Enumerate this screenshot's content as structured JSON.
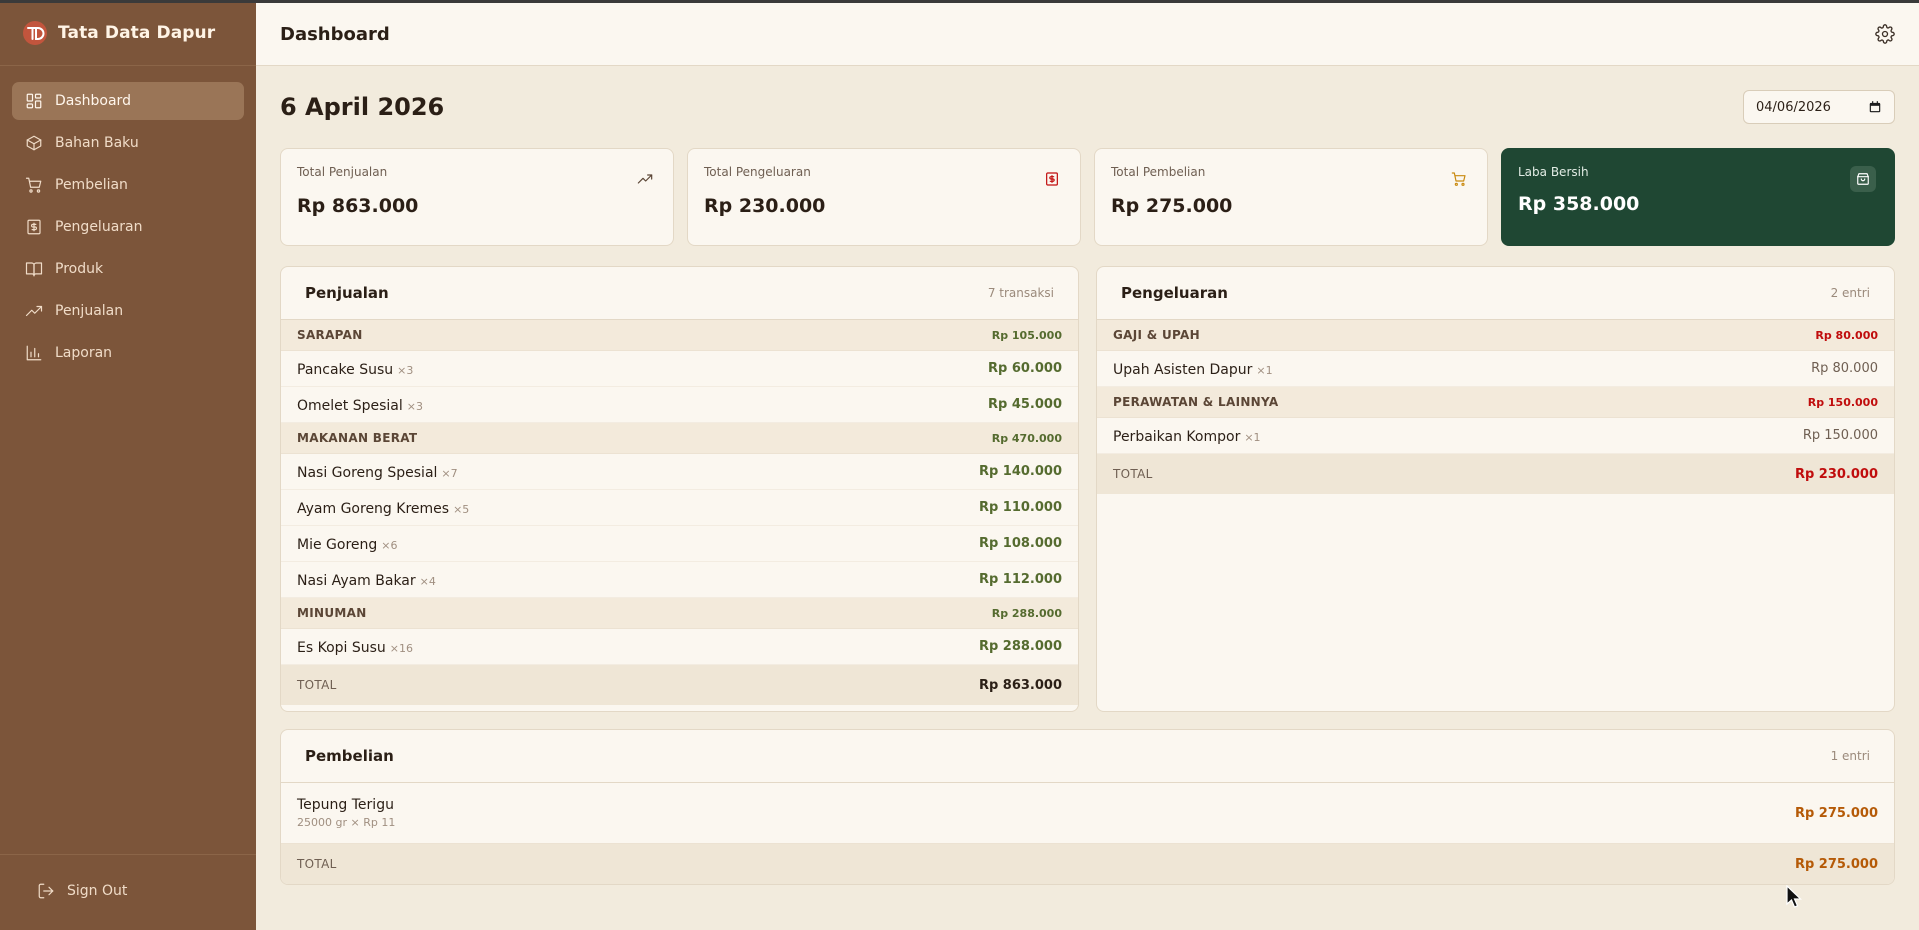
{
  "app": {
    "name": "Tata Data Dapur"
  },
  "sidebar": {
    "items": [
      {
        "label": "Dashboard",
        "icon": "dashboard-icon",
        "active": true
      },
      {
        "label": "Bahan Baku",
        "icon": "box-icon",
        "active": false
      },
      {
        "label": "Pembelian",
        "icon": "cart-icon",
        "active": false
      },
      {
        "label": "Pengeluaran",
        "icon": "receipt-icon",
        "active": false
      },
      {
        "label": "Produk",
        "icon": "book-icon",
        "active": false
      },
      {
        "label": "Penjualan",
        "icon": "trend-icon",
        "active": false
      },
      {
        "label": "Laporan",
        "icon": "bar-chart-icon",
        "active": false
      }
    ],
    "signout": "Sign Out"
  },
  "header": {
    "title": "Dashboard"
  },
  "date": {
    "title": "6 April 2026",
    "input_value": "04/06/2026"
  },
  "stats": {
    "sales": {
      "label": "Total Penjualan",
      "value": "Rp 863.000"
    },
    "expenses": {
      "label": "Total Pengeluaran",
      "value": "Rp 230.000"
    },
    "purchases": {
      "label": "Total Pembelian",
      "value": "Rp 275.000"
    },
    "profit": {
      "label": "Laba Bersih",
      "value": "Rp 358.000"
    }
  },
  "sales_panel": {
    "title": "Penjualan",
    "count": "7 transaksi",
    "categories": [
      {
        "name": "SARAPAN",
        "total": "Rp 105.000",
        "items": [
          {
            "name": "Pancake Susu",
            "qty": "×3",
            "amount": "Rp 60.000"
          },
          {
            "name": "Omelet Spesial",
            "qty": "×3",
            "amount": "Rp 45.000"
          }
        ]
      },
      {
        "name": "MAKANAN BERAT",
        "total": "Rp 470.000",
        "items": [
          {
            "name": "Nasi Goreng Spesial",
            "qty": "×7",
            "amount": "Rp 140.000"
          },
          {
            "name": "Ayam Goreng Kremes",
            "qty": "×5",
            "amount": "Rp 110.000"
          },
          {
            "name": "Mie Goreng",
            "qty": "×6",
            "amount": "Rp 108.000"
          },
          {
            "name": "Nasi Ayam Bakar",
            "qty": "×4",
            "amount": "Rp 112.000"
          }
        ]
      },
      {
        "name": "MINUMAN",
        "total": "Rp 288.000",
        "items": [
          {
            "name": "Es Kopi Susu",
            "qty": "×16",
            "amount": "Rp 288.000"
          }
        ]
      }
    ],
    "total_label": "TOTAL",
    "total_value": "Rp 863.000"
  },
  "expense_panel": {
    "title": "Pengeluaran",
    "count": "2 entri",
    "categories": [
      {
        "name": "GAJI & UPAH",
        "total": "Rp 80.000",
        "items": [
          {
            "name": "Upah Asisten Dapur",
            "qty": "×1",
            "amount": "Rp 80.000"
          }
        ]
      },
      {
        "name": "PERAWATAN & LAINNYA",
        "total": "Rp 150.000",
        "items": [
          {
            "name": "Perbaikan Kompor",
            "qty": "×1",
            "amount": "Rp 150.000"
          }
        ]
      }
    ],
    "total_label": "TOTAL",
    "total_value": "Rp 230.000"
  },
  "purchase_panel": {
    "title": "Pembelian",
    "count": "1 entri",
    "items": [
      {
        "name": "Tepung Terigu",
        "detail": "25000 gr × Rp 11",
        "amount": "Rp 275.000"
      }
    ],
    "total_label": "TOTAL",
    "total_value": "Rp 275.000"
  },
  "colors": {
    "sidebar": "#7c553a",
    "background": "#f2ebdd",
    "profit_card": "#1f4733",
    "sales_green": "#556b2f",
    "expense_red": "#c00d0d",
    "purchase_orange": "#b55a07"
  }
}
